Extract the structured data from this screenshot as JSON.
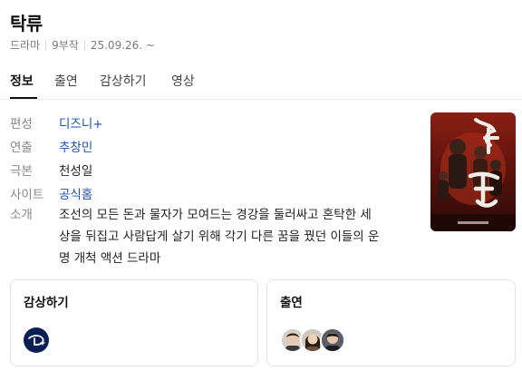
{
  "header": {
    "title": "탁류",
    "genre": "드라마",
    "episodes": "9부작",
    "air_date": "25.09.26. ~"
  },
  "tabs": [
    {
      "label": "정보",
      "active": true
    },
    {
      "label": "출연",
      "active": false
    },
    {
      "label": "감상하기",
      "active": false
    },
    {
      "label": "영상",
      "active": false
    }
  ],
  "info": {
    "channel": {
      "label": "편성",
      "value": "디즈니+"
    },
    "director": {
      "label": "연출",
      "value": "추창민"
    },
    "writer": {
      "label": "극본",
      "value": "천성일"
    },
    "site": {
      "label": "사이트",
      "value": "공식홈"
    },
    "synopsis": {
      "label": "소개",
      "lines": [
        "조선의 모든 돈과 물자가 모여드는 경강을 둘러싸고 혼탁한 세",
        "상을 뒤집고 사람답게 살기 위해 각기 다른 꿈을 꿨던 이들의 운",
        "명 개척 액션 드라마"
      ]
    }
  },
  "cards": {
    "watch": {
      "title": "감상하기",
      "provider_icon": "disney-plus-icon"
    },
    "cast": {
      "title": "출연"
    }
  },
  "colors": {
    "link": "#1a4fb4",
    "disney_bg": "#0b1f55"
  }
}
